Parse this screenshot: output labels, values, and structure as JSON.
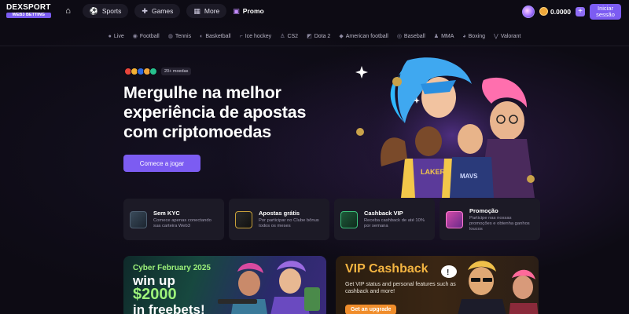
{
  "header": {
    "logo_main": "DEXSPORT",
    "logo_sub": "WEB3 BETTING",
    "nav": [
      {
        "label": "Sports",
        "icon": "soccer-ball-icon"
      },
      {
        "label": "Games",
        "icon": "gamepad-icon"
      },
      {
        "label": "More",
        "icon": "grid-icon"
      }
    ],
    "promo_label": "Promo",
    "balance": "0.0000",
    "login_label": "Iniciar sessão"
  },
  "sports": [
    {
      "label": "Live",
      "icon": "live-dot-icon"
    },
    {
      "label": "Football",
      "icon": "football-icon"
    },
    {
      "label": "Tennis",
      "icon": "tennis-icon"
    },
    {
      "label": "Basketball",
      "icon": "basketball-icon"
    },
    {
      "label": "Ice hockey",
      "icon": "hockey-icon"
    },
    {
      "label": "CS2",
      "icon": "cs2-icon"
    },
    {
      "label": "Dota 2",
      "icon": "dota-icon"
    },
    {
      "label": "American football",
      "icon": "american-football-icon"
    },
    {
      "label": "Baseball",
      "icon": "baseball-icon"
    },
    {
      "label": "MMA",
      "icon": "mma-icon"
    },
    {
      "label": "Boxing",
      "icon": "boxing-icon"
    },
    {
      "label": "Valorant",
      "icon": "valorant-icon"
    }
  ],
  "hero": {
    "coins_badge": "20+ moedas",
    "title_line1": "Mergulhe na melhor",
    "title_line2": "experiência de apostas",
    "title_line3": "com criptomoedas",
    "cta": "Comece a jogar"
  },
  "features": [
    {
      "title": "Sem KYC",
      "desc": "Comece apenas conectando sua carteira Web3",
      "icon": "wallet-icon"
    },
    {
      "title": "Apostas grátis",
      "desc": "Por participar no Clube bônus todos os meses",
      "icon": "gift-bag-icon"
    },
    {
      "title": "Cashback VIP",
      "desc": "Receba cashback de até 10% por semana",
      "icon": "cashback-icon"
    },
    {
      "title": "Promoção",
      "desc": "Participe nas nossas promoções e obtenha ganhos loucos",
      "icon": "gift-box-icon"
    }
  ],
  "banners": {
    "cyber": {
      "eyebrow": "Cyber February 2025",
      "line1": "win up",
      "amount": "$2000",
      "line3": "in freebets!"
    },
    "vip": {
      "title": "VIP Cashback",
      "desc": "Get VIP status and personal features such as cashback and more!",
      "button": "Get an upgrade"
    }
  },
  "colors": {
    "accent": "#7c5cf2",
    "background": "#0d0b14",
    "card": "#1c1a26",
    "green": "#9df27a",
    "gold": "#f3b441"
  }
}
